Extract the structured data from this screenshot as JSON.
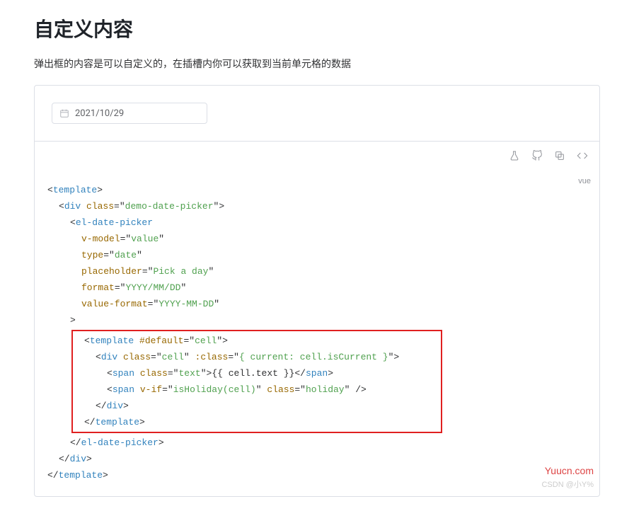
{
  "heading": "自定义内容",
  "description": "弹出框的内容是可以自定义的，在插槽内你可以获取到当前单元格的数据",
  "date_value": "2021/10/29",
  "lang": "vue",
  "code": {
    "t_template": "template",
    "t_div": "div",
    "t_el_date_picker": "el-date-picker",
    "t_span": "span",
    "a_class": "class",
    "a_vmodel": "v-model",
    "a_type": "type",
    "a_placeholder": "placeholder",
    "a_format": "format",
    "a_value_format": "value-format",
    "a_default": "#default",
    "a_bind_class": ":class",
    "a_vif": "v-if",
    "v_demo": "demo-date-picker",
    "v_value": "value",
    "v_date": "date",
    "v_pick": "Pick a day",
    "v_fmt": "YYYY/MM/DD",
    "v_valfmt": "YYYY-MM-DD",
    "v_cell": "cell",
    "v_cellcls": "cell",
    "v_current": "{ current: cell.isCurrent }",
    "v_text": "text",
    "v_celltext": "{{ cell.text }}",
    "v_isholiday": "isHoliday(cell)",
    "v_holiday": "holiday"
  },
  "watermark1": "Yuucn.com",
  "watermark2": "CSDN @小Y%"
}
